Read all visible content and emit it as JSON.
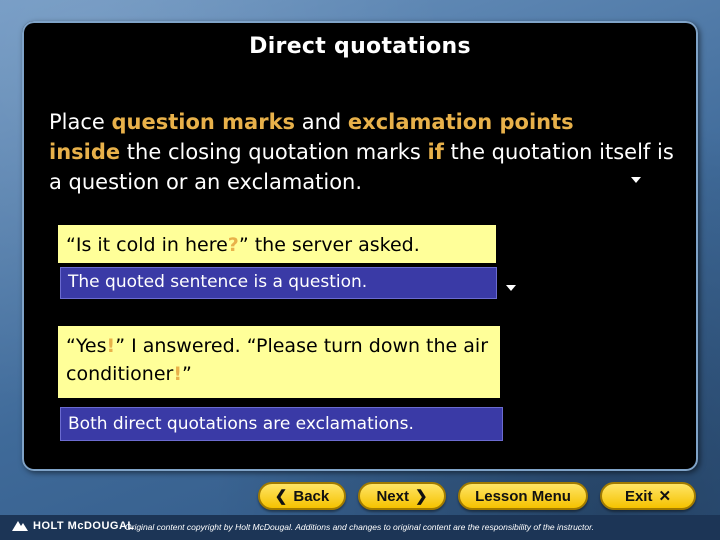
{
  "slide": {
    "title": "Direct quotations",
    "intro": {
      "p1": "Place ",
      "h1": "question marks",
      "p2": " and ",
      "h2": "exclamation points",
      "p3": " ",
      "h3": "inside",
      "p4": " the closing quotation marks ",
      "h4": "if",
      "p5": " the quotation itself is a question or an exclamation."
    },
    "example1": {
      "quote_open": "“Is it cold in here",
      "mark": "?",
      "quote_close": "”",
      "rest": " the server asked.",
      "note": "The quoted sentence is a question."
    },
    "example2": {
      "part1": "“Yes",
      "mark1": "!",
      "part2": "” I answered. “Please turn down the air conditioner",
      "mark2": "!",
      "part3": "”",
      "note": "Both direct quotations are exclamations."
    }
  },
  "nav": {
    "back": "Back",
    "next": "Next",
    "lesson_menu": "Lesson Menu",
    "exit": "Exit"
  },
  "footer": {
    "logo": "HOLT McDOUGAL",
    "copyright": "Original content copyright by Holt McDougal. Additions and changes to original content are the responsibility of the instructor."
  },
  "colors": {
    "highlight": "#e8b14a",
    "quote_bg": "#ffff99",
    "note_bg": "#3a3aa6",
    "button": "#f5c200"
  }
}
